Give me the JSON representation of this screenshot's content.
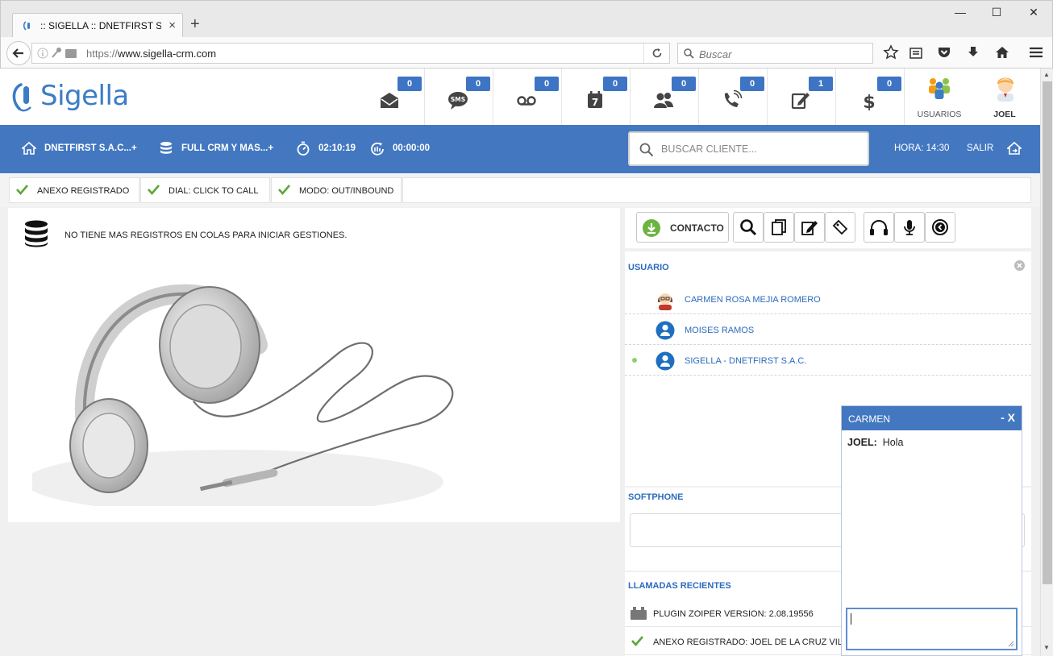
{
  "browser": {
    "tab_title": ":: SIGELLA :: DNETFIRST S....",
    "url_scheme": "https://",
    "url_host": "www.sigella-crm.com",
    "search_placeholder": "Buscar"
  },
  "header": {
    "logo_text": "Sigella",
    "icons": [
      {
        "name": "mail-icon",
        "count": "0"
      },
      {
        "name": "sms-icon",
        "count": "0"
      },
      {
        "name": "voicemail-icon",
        "count": "0"
      },
      {
        "name": "calendar-icon",
        "count": "0"
      },
      {
        "name": "contacts-icon",
        "count": "0"
      },
      {
        "name": "phone-icon",
        "count": "0"
      },
      {
        "name": "edit-icon",
        "count": "1"
      },
      {
        "name": "dollar-icon",
        "count": "0"
      }
    ],
    "usuarios_label": "USUARIOS",
    "user_label": "JOEL"
  },
  "toolbar": {
    "company": "DNETFIRST S.A.C...+",
    "campaign": "FULL CRM Y MAS...+",
    "session_time": "02:10:19",
    "call_time": "00:00:00",
    "client_search_placeholder": "BUSCAR CLIENTE...",
    "hora": "HORA: 14:30",
    "salir": "SALIR"
  },
  "status": {
    "anexo": "ANEXO REGISTRADO",
    "dial": "DIAL: CLICK TO CALL",
    "modo": "MODO: OUT/INBOUND"
  },
  "main": {
    "queue_message": "NO TIENE MAS REGISTROS EN COLAS PARA INICIAR GESTIONES."
  },
  "right": {
    "contacto_label": "CONTACTO",
    "usuario_title": "USUARIO",
    "users": [
      {
        "name": "CARMEN ROSA MEJIA ROMERO"
      },
      {
        "name": "MOISES RAMOS"
      },
      {
        "name": "SIGELLA - DNETFIRST S.A.C."
      }
    ],
    "softphone_title": "SOFTPHONE",
    "llamadas_title": "LLAMADAS RECIENTES",
    "plugin_text": "PLUGIN ZOIPER VERSION: 2.08.19556",
    "anexo_text": "ANEXO REGISTRADO: JOEL DE LA CRUZ VILLAR"
  },
  "chat": {
    "contact": "CARMEN",
    "controls": "- X",
    "messages": [
      {
        "from": "JOEL:",
        "text": "Hola"
      }
    ]
  },
  "colors": {
    "brand_blue": "#4378c1",
    "badge_blue": "#3d74c4",
    "link_blue": "#2c6bbd",
    "check_green": "#5aa83a"
  }
}
